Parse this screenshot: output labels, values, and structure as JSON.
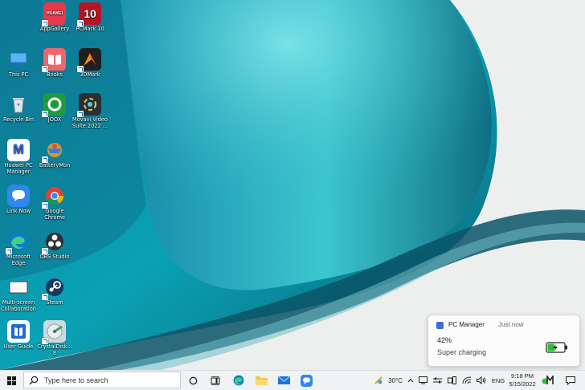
{
  "desktop": {
    "icons": [
      {
        "label": "AppGallery",
        "glyph": "HUAWEI",
        "color": "#e8394b"
      },
      {
        "label": "PCMark 10",
        "glyph": "10",
        "color": "#b51523"
      },
      {
        "label": "This PC",
        "glyph": "",
        "color": "#3b8fd8"
      },
      {
        "label": "Books",
        "glyph": "",
        "color": "#f0656b"
      },
      {
        "label": "3DMark",
        "glyph": "",
        "color": "#1f1f1f"
      },
      {
        "label": "Recycle Bin",
        "glyph": "",
        "color": "#e6e9ec"
      },
      {
        "label": "JOOX",
        "glyph": "",
        "color": "#1d9c3e"
      },
      {
        "label": "Movavi Video Suite 2022 ...",
        "glyph": "",
        "color": "#2a2f36"
      },
      {
        "label": "Huawei PC Manager",
        "glyph": "M",
        "color": "#ffffff"
      },
      {
        "label": "BatteryMon",
        "glyph": "",
        "color": "#d9982d"
      },
      {
        "label": "Link Now",
        "glyph": "",
        "color": "#2f87f0"
      },
      {
        "label": "Google Chrome",
        "glyph": "",
        "color": "#ffffff"
      },
      {
        "label": "Microsoft Edge",
        "glyph": "",
        "color": "#0f7bd6"
      },
      {
        "label": "OBS Studio",
        "glyph": "",
        "color": "#302e31"
      },
      {
        "label": "Multi-screen Collaboration",
        "glyph": "",
        "color": "#ffffff"
      },
      {
        "label": "Steam",
        "glyph": "",
        "color": "#17385e"
      },
      {
        "label": "User Guide",
        "glyph": "",
        "color": "#1e6bd1"
      },
      {
        "label": "CrystalDisk... 8",
        "glyph": "",
        "color": "#cfd8dc"
      }
    ]
  },
  "notification": {
    "app_name": "PC Manager",
    "time": "Just now",
    "battery_percent_text": "42%",
    "status": "Super charging",
    "battery_level": 0.42,
    "battery_color": "#2fbf3a"
  },
  "taskbar": {
    "search_placeholder": "Type here to search",
    "pinned": [
      "cortana-icon",
      "task-view-icon",
      "edge-icon",
      "file-explorer-icon",
      "mail-icon",
      "link-now-icon"
    ],
    "weather": "30°C",
    "language": "ENG",
    "time": "9:18 PM",
    "date": "5/15/2022"
  }
}
